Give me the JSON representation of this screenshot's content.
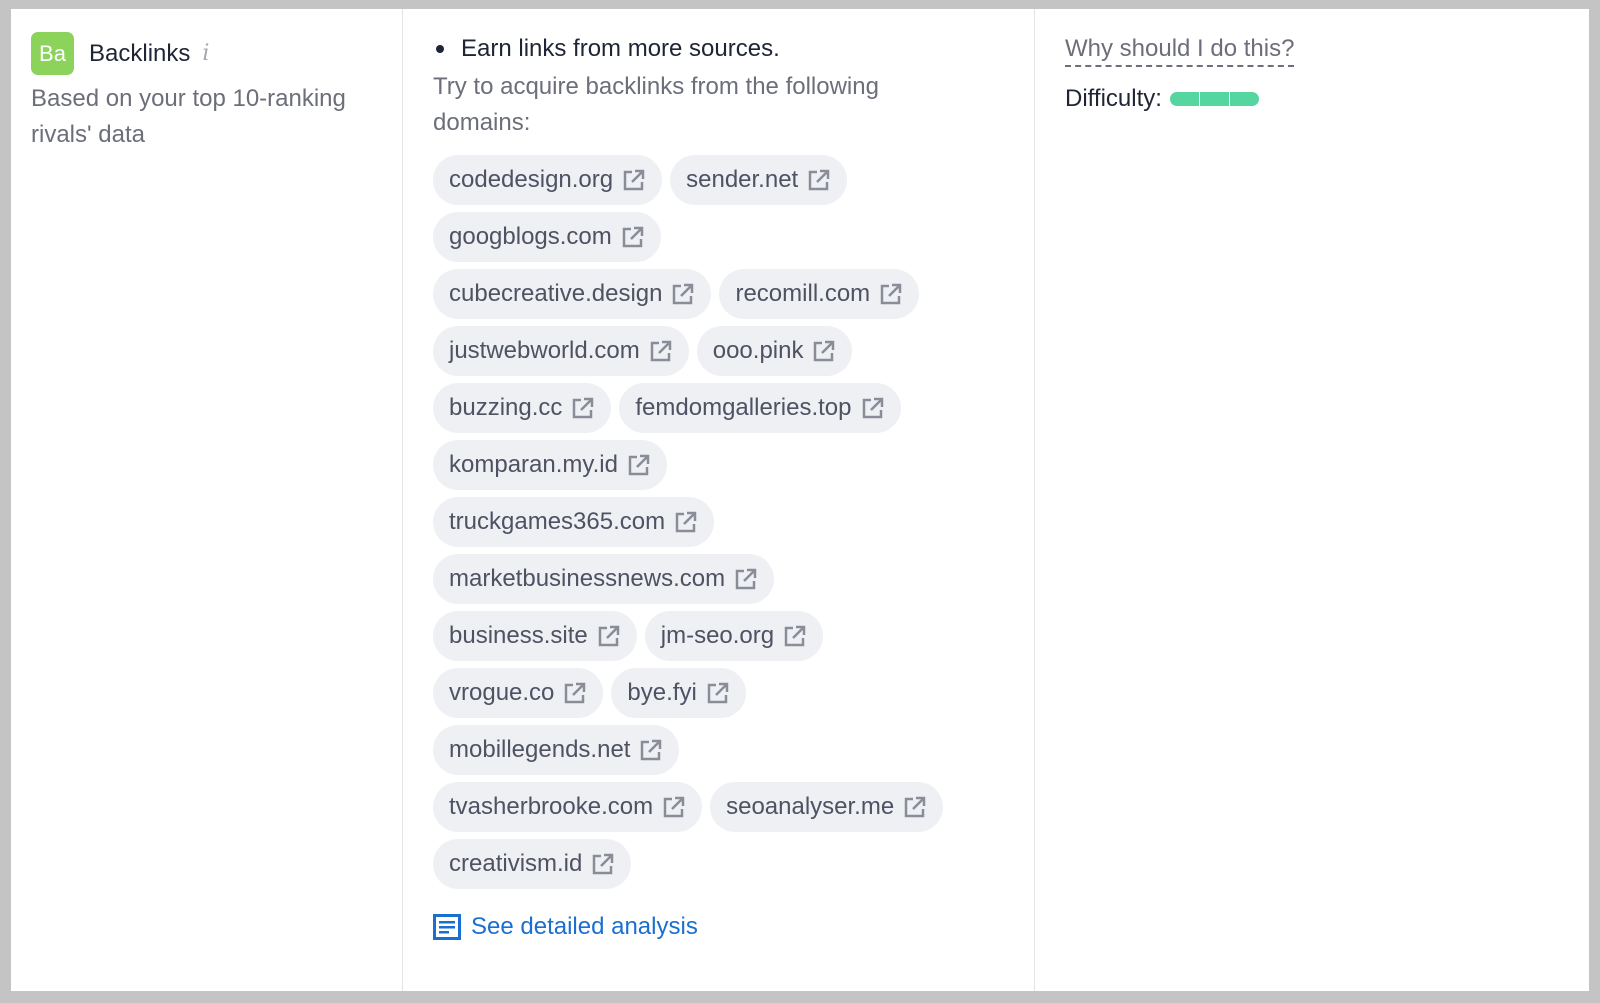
{
  "card": {
    "badge": "Ba",
    "title": "Backlinks",
    "info_icon": "i",
    "subtitle": "Based on your top 10-ranking rivals' data"
  },
  "task": {
    "bullet": "Earn links from more sources.",
    "description": "Try to acquire backlinks from the following domains:",
    "domain_rows": [
      [
        "codedesign.org",
        "sender.net"
      ],
      [
        "googblogs.com"
      ],
      [
        "cubecreative.design",
        "recomill.com"
      ],
      [
        "justwebworld.com",
        "ooo.pink"
      ],
      [
        "buzzing.cc",
        "femdomgalleries.top"
      ],
      [
        "komparan.my.id"
      ],
      [
        "truckgames365.com"
      ],
      [
        "marketbusinessnews.com"
      ],
      [
        "business.site",
        "jm-seo.org"
      ],
      [
        "vrogue.co",
        "bye.fyi"
      ],
      [
        "mobillegends.net"
      ],
      [
        "tvasherbrooke.com",
        "seoanalyser.me"
      ],
      [
        "creativism.id"
      ]
    ],
    "analysis_link": "See detailed analysis"
  },
  "side": {
    "why_link": "Why should I do this?",
    "difficulty_label": "Difficulty:",
    "difficulty_level": 3,
    "difficulty_max": 3,
    "difficulty_color": "#55d6a0"
  }
}
